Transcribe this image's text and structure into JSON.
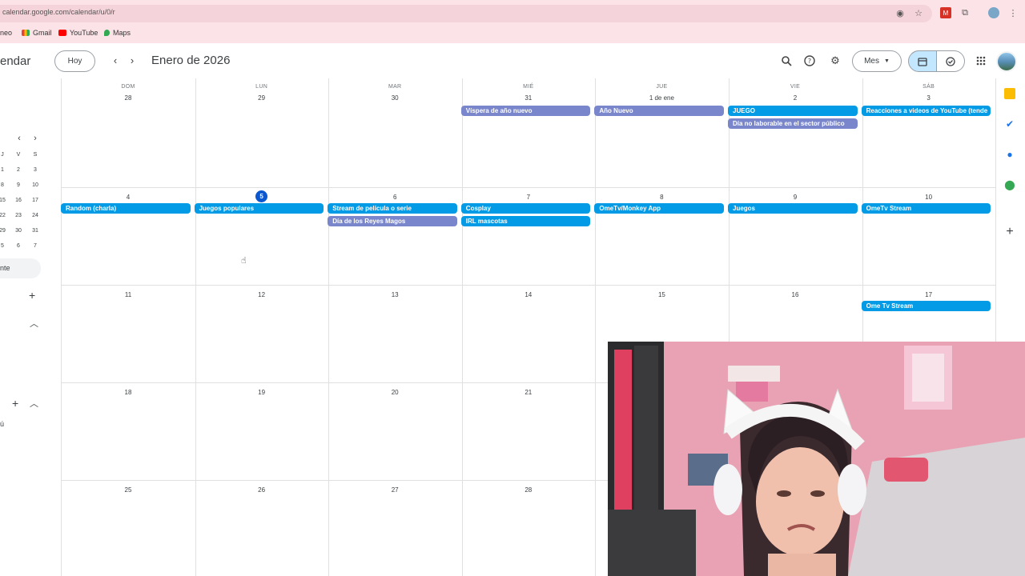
{
  "browser": {
    "url": "calendar.google.com/calendar/u/0/r",
    "bookmarks": [
      "neo",
      "Gmail",
      "YouTube",
      "Maps"
    ]
  },
  "header": {
    "app_title": "endar",
    "today_label": "Hoy",
    "prev_icon": "chevron-left-icon",
    "next_icon": "chevron-right-icon",
    "month_title": "Enero de 2026",
    "view_label": "Mes"
  },
  "sidebar": {
    "mini_calendar": {
      "weekday_headers": [
        "J",
        "V",
        "S"
      ],
      "rows": [
        [
          "1",
          "2",
          "3"
        ],
        [
          "8",
          "9",
          "10"
        ],
        [
          "15",
          "16",
          "17"
        ],
        [
          "22",
          "23",
          "24"
        ],
        [
          "29",
          "30",
          "31"
        ],
        [
          "5",
          "6",
          "7"
        ]
      ]
    },
    "selected_item": "nte",
    "bottom_item": "ú"
  },
  "calendar": {
    "weekdays": [
      "DOM",
      "LUN",
      "MAR",
      "MIÉ",
      "JUE",
      "VIE",
      "SÁB"
    ],
    "weeks": [
      [
        "28",
        "29",
        "30",
        "31",
        "1 de ene",
        "2",
        "3"
      ],
      [
        "4",
        "5",
        "6",
        "7",
        "8",
        "9",
        "10"
      ],
      [
        "11",
        "12",
        "13",
        "14",
        "15",
        "16",
        "17"
      ],
      [
        "18",
        "19",
        "20",
        "21",
        "",
        "",
        ""
      ],
      [
        "25",
        "26",
        "27",
        "28",
        "",
        "",
        ""
      ]
    ],
    "today": "5",
    "events": [
      {
        "week": 0,
        "day": 3,
        "slot": 0,
        "title": "Víspera de año nuevo",
        "color": "#7986cb"
      },
      {
        "week": 0,
        "day": 4,
        "slot": 0,
        "title": "Año Nuevo",
        "color": "#7986cb"
      },
      {
        "week": 0,
        "day": 5,
        "slot": 0,
        "title": "JUEGO",
        "color": "#039be5"
      },
      {
        "week": 0,
        "day": 5,
        "slot": 1,
        "title": "Día no laborable en el sector público",
        "color": "#7986cb"
      },
      {
        "week": 0,
        "day": 6,
        "slot": 0,
        "title": "Reacciones a videos de YouTube (tende",
        "color": "#039be5"
      },
      {
        "week": 1,
        "day": 0,
        "slot": 0,
        "title": "Random (charla)",
        "color": "#039be5"
      },
      {
        "week": 1,
        "day": 1,
        "slot": 0,
        "title": "Juegos populares",
        "color": "#039be5"
      },
      {
        "week": 1,
        "day": 2,
        "slot": 0,
        "title": "Stream de película o serie",
        "color": "#039be5"
      },
      {
        "week": 1,
        "day": 2,
        "slot": 1,
        "title": "Día de los Reyes Magos",
        "color": "#7986cb"
      },
      {
        "week": 1,
        "day": 3,
        "slot": 0,
        "title": "Cosplay",
        "color": "#039be5"
      },
      {
        "week": 1,
        "day": 3,
        "slot": 1,
        "title": "IRL mascotas",
        "color": "#039be5"
      },
      {
        "week": 1,
        "day": 4,
        "slot": 0,
        "title": "OmeTv/Monkey App",
        "color": "#039be5"
      },
      {
        "week": 1,
        "day": 5,
        "slot": 0,
        "title": "Juegos",
        "color": "#039be5"
      },
      {
        "week": 1,
        "day": 6,
        "slot": 0,
        "title": "OmeTv Stream",
        "color": "#039be5"
      },
      {
        "week": 2,
        "day": 6,
        "slot": 0,
        "title": "Ome Tv Stream",
        "color": "#039be5"
      }
    ]
  },
  "colors": {
    "accent": "#0b57d0",
    "event_blue": "#039be5",
    "event_lavender": "#7986cb",
    "browser_pink": "#fbe3e8"
  }
}
